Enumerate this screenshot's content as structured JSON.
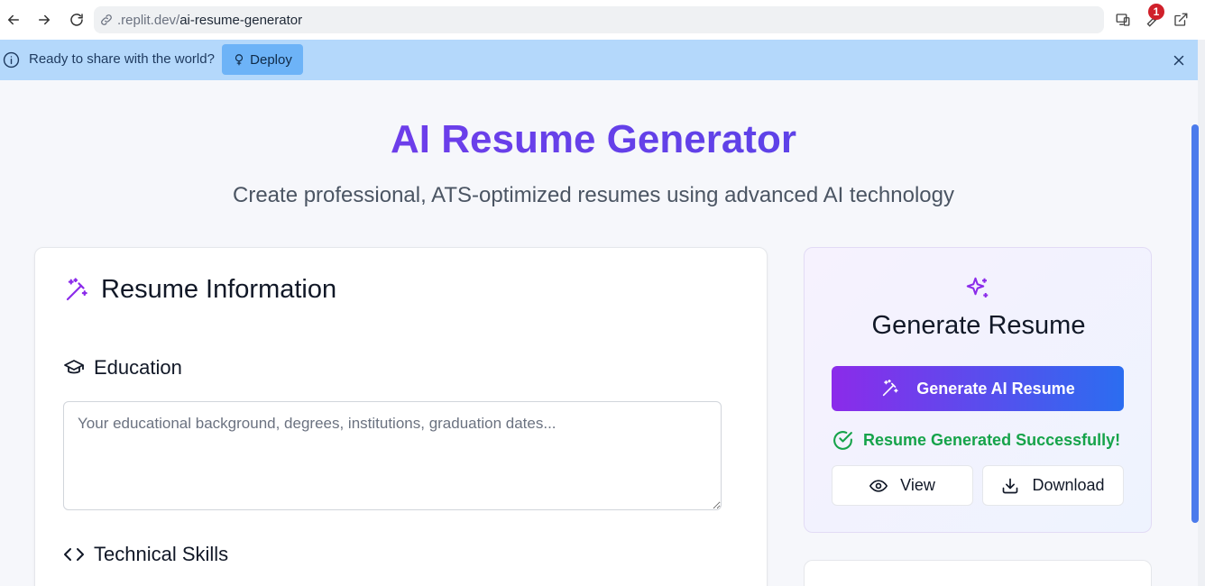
{
  "browser": {
    "url_host": ".replit.dev/",
    "url_path": "ai-resume-generator",
    "notification_count": "1"
  },
  "banner": {
    "message": "Ready to share with the world?",
    "deploy_label": "Deploy"
  },
  "header": {
    "title": "AI Resume Generator",
    "subtitle": "Create professional, ATS-optimized resumes using advanced AI technology"
  },
  "form": {
    "title": "Resume Information",
    "education": {
      "label": "Education",
      "placeholder": "Your educational background, degrees, institutions, graduation dates...",
      "value": ""
    },
    "skills": {
      "label": "Technical Skills"
    }
  },
  "generate": {
    "title": "Generate Resume",
    "button_label": "Generate AI Resume",
    "status": "Resume Generated Successfully!",
    "view_label": "View",
    "download_label": "Download"
  },
  "colors": {
    "accent_purple": "#7c3aed",
    "accent_blue": "#2b6df0",
    "success_green": "#16a34a",
    "banner_bg": "#b4d8fb"
  }
}
